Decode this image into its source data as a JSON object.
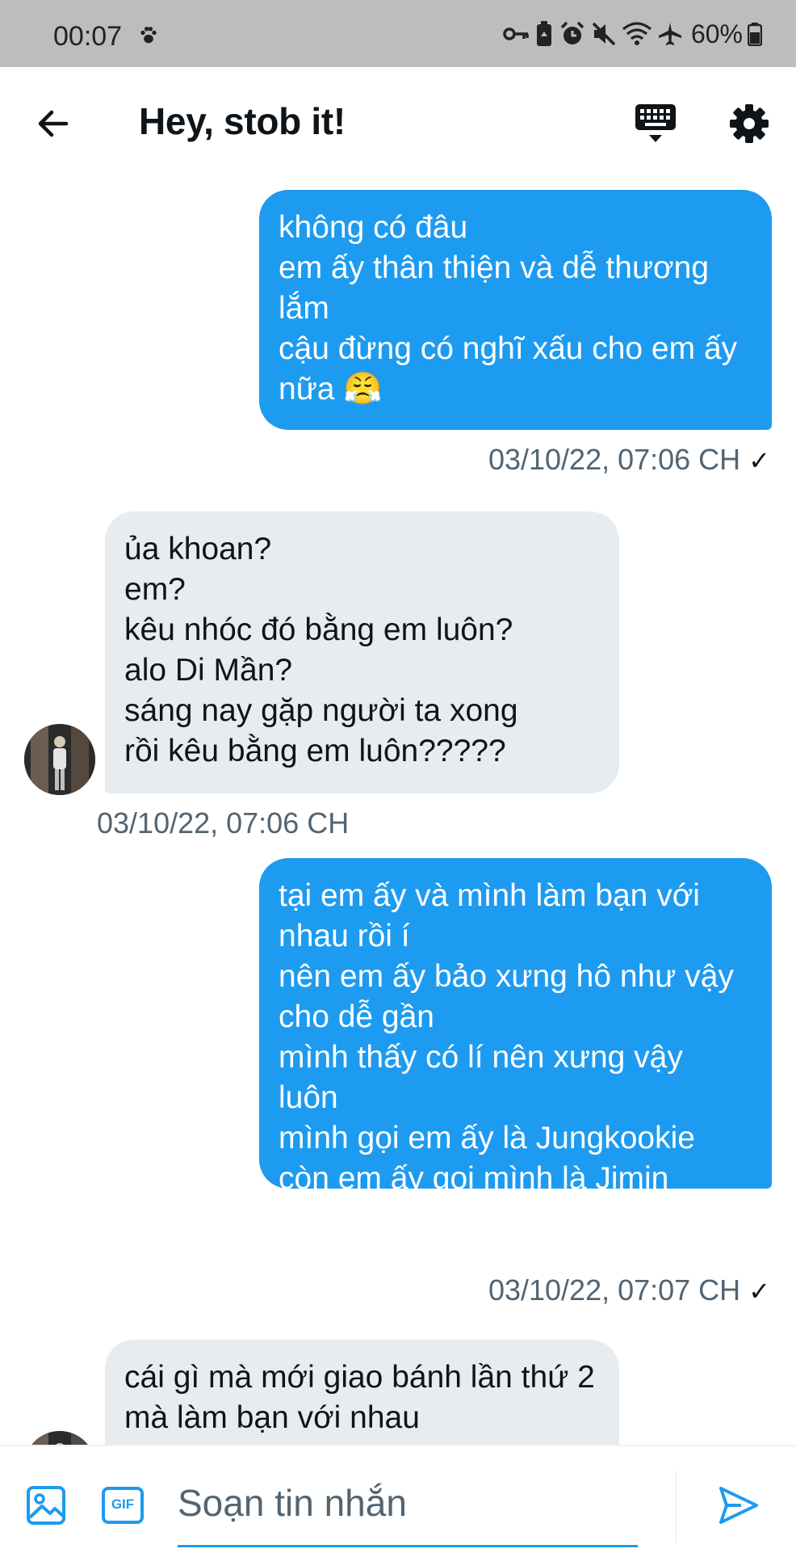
{
  "status_bar": {
    "time": "00:07",
    "battery": "60%",
    "icons": [
      "paw-icon",
      "key-icon",
      "battery-saver-icon",
      "alarm-icon",
      "mute-icon",
      "wifi-icon",
      "airplane-icon",
      "battery-icon"
    ]
  },
  "header": {
    "title": "Hey, stob it!",
    "back_icon": "arrow-left-icon",
    "keyboard_icon": "keyboard-icon",
    "settings_icon": "gear-icon"
  },
  "messages": [
    {
      "direction": "sent",
      "text": "không có đâu\nem ấy thân thiện và dễ thương lắm\ncậu đừng có nghĩ xấu cho em ấy nữa 😤",
      "timestamp": "03/10/22, 07:06 CH",
      "status": "✓"
    },
    {
      "direction": "received",
      "text": "ủa khoan?\nem?\nkêu nhóc đó bằng em luôn?\nalo Di Mần?\nsáng nay gặp người ta xong\nrồi kêu bằng em luôn?????",
      "timestamp": "03/10/22, 07:06 CH"
    },
    {
      "direction": "sent",
      "text": "tại em ấy và mình làm bạn với nhau rồi í\nnên em ấy bảo xưng hô như vậy cho dễ gần\nmình thấy có lí nên xưng vậy luôn\nmình gọi em ấy là Jungkookie\ncòn em ấy gọi mình là Jimin hyung~~~",
      "timestamp": "03/10/22, 07:07 CH",
      "status": "✓"
    },
    {
      "direction": "received",
      "text": "cái gì mà mới giao bánh lần thứ 2 mà làm bạn với nhau"
    }
  ],
  "composer": {
    "placeholder": "Soạn tin nhắn",
    "value": "",
    "media_icon": "image-icon",
    "gif_label": "GIF",
    "send_icon": "send-icon"
  },
  "colors": {
    "accent": "#1d9bf0",
    "received_bubble": "#e7ecf0",
    "secondary_text": "#536471",
    "status_bar_bg": "#bdbdbd"
  }
}
